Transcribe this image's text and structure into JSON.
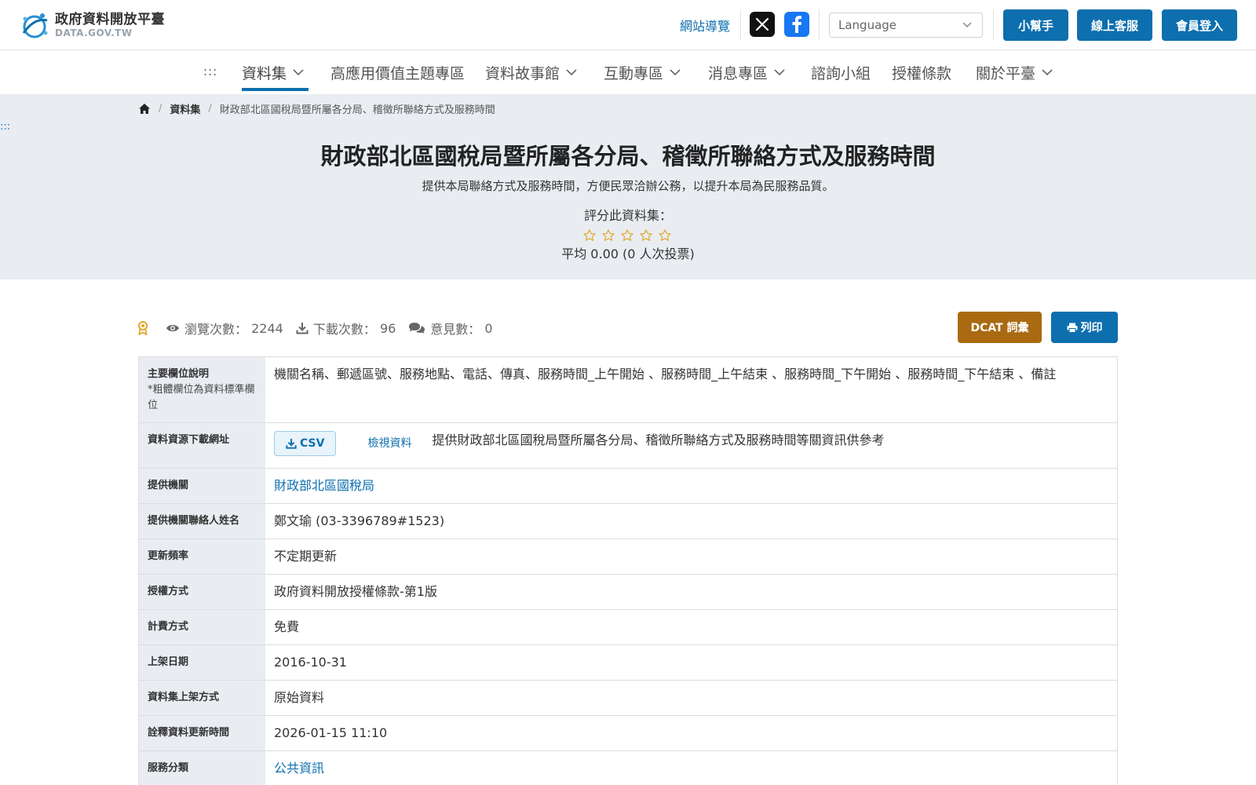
{
  "header": {
    "logo_title": "政府資料開放平臺",
    "logo_sub": "DATA.GOV.TW",
    "sitemap": "網站導覽",
    "language_placeholder": "Language",
    "helper_btn": "小幫手",
    "support_btn": "線上客服",
    "login_btn": "會員登入",
    "brand_color": "#0d6fae"
  },
  "nav": {
    "dots": ":::",
    "items": [
      {
        "label": "資料集",
        "has_menu": true
      },
      {
        "label": "高應用價值主題專區",
        "has_menu": false
      },
      {
        "label": "資料故事館",
        "has_menu": true
      },
      {
        "label": "互動專區",
        "has_menu": true
      },
      {
        "label": "消息專區",
        "has_menu": true
      },
      {
        "label": "諮詢小組",
        "has_menu": false
      },
      {
        "label": "授權條款",
        "has_menu": false
      },
      {
        "label": "關於平臺",
        "has_menu": true
      }
    ]
  },
  "breadcrumb": {
    "items": [
      "資料集",
      "財政部北區國稅局暨所屬各分局、稽徵所聯絡方式及服務時間"
    ]
  },
  "side_dots": ":::",
  "dataset": {
    "title": "財政部北區國稅局暨所屬各分局、稽徵所聯絡方式及服務時間",
    "description": "提供本局聯絡方式及服務時間，方便民眾洽辦公務，以提升本局為民服務品質。",
    "rate_label": "評分此資料集：",
    "rating_stars": 0,
    "rating_max": 5,
    "rating_avg": "平均 0.00 (0 人次投票)"
  },
  "stats": {
    "views_label": "瀏覽次數：",
    "views": "2244",
    "downloads_label": "下載次數：",
    "downloads": "96",
    "comments_label": "意見數：",
    "comments": "0"
  },
  "actions": {
    "dcat": "DCAT 詞彙",
    "print": "列印",
    "dcat_color": "#a96a12"
  },
  "table": {
    "fields_label": "主要欄位說明",
    "fields_note": "*粗體欄位為資料標準欄位",
    "fields_value": "機關名稱、郵遞區號、服務地點、電話、傳真、服務時間_上午開始 、服務時間_上午結束 、服務時間_下午開始 、服務時間_下午結束 、備註",
    "resource_label": "資料資源下載網址",
    "resource_format": "CSV",
    "resource_view": "檢視資料",
    "resource_desc": "提供財政部北區國稅局暨所屬各分局、稽徵所聯絡方式及服務時間等關資訊供參考",
    "provider_label": "提供機關",
    "provider": "財政部北區國稅局",
    "contact_label": "提供機關聯絡人姓名",
    "contact": "鄭文瑜 (03-3396789#1523)",
    "freq_label": "更新頻率",
    "freq": "不定期更新",
    "license_label": "授權方式",
    "license": "政府資料開放授權條款-第1版",
    "fee_label": "計費方式",
    "fee": "免費",
    "publish_label": "上架日期",
    "publish": "2016-10-31",
    "method_label": "資料集上架方式",
    "method": "原始資料",
    "meta_updated_label": "詮釋資料更新時間",
    "meta_updated": "2026-01-15 11:10",
    "category_label": "服務分類",
    "category": "公共資訊"
  }
}
